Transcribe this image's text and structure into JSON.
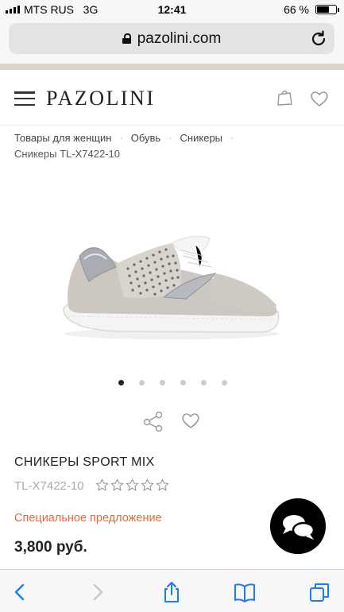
{
  "status_bar": {
    "carrier": "MTS RUS",
    "network": "3G",
    "time": "12:41",
    "battery": "66 %",
    "battery_level": 0.66
  },
  "browser": {
    "url": "pazolini.com"
  },
  "header": {
    "logo": "PAZOLINI"
  },
  "breadcrumb": {
    "items": [
      "Товары для женщин",
      "Обувь",
      "Сникеры"
    ],
    "current": "Сникеры TL-X7422-10"
  },
  "gallery": {
    "image_count": 6,
    "active_index": 0
  },
  "product": {
    "title_prefix": "СНИКЕРЫ",
    "title_suffix": "SPORT MIX",
    "sku": "TL-X7422-10",
    "rating": 0,
    "rating_max": 5,
    "special_offer": "Специальное предложение",
    "price": "3,800 руб."
  },
  "colors": {
    "accent_line": "#ddd2c9",
    "special_offer": "#e56a3c",
    "ios_blue": "#1a7cf5"
  }
}
